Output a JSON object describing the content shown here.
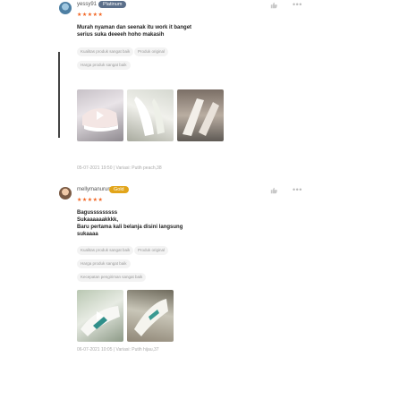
{
  "reviews": [
    {
      "username": "yessy91",
      "badge": "Platinum",
      "stars": "★★★★★",
      "text": [
        "Murah nyaman dan seenak itu work it banget",
        "serius suka deeeeh hoho makasih"
      ],
      "tags": [
        "Kualitas produk sangat baik",
        "Produk original",
        "Harga produk sangat baik"
      ],
      "meta": "05-07-2021 19:50 | Variasi: Putih peach,38"
    },
    {
      "username": "mellymanurung09",
      "badge": "Gold",
      "stars": "★★★★★",
      "text": [
        "Bagusssssssss",
        "Sukaaaaaakkkk,",
        "Baru pertama kali belanja disini langsung",
        "sukaaaa"
      ],
      "tags": [
        "Kualitas produk sangat baik",
        "Produk original",
        "Harga produk sangat baik",
        "Kecepatan pengiriman sangat baik"
      ],
      "meta": "06-07-2021 10:05 | Variasi: Putih hijau,37"
    }
  ],
  "colors": {
    "star": "#f26522",
    "platinum": "#5b6f8a",
    "gold": "#e2a51a",
    "tag_bg": "#f3f3f3"
  },
  "icons": {
    "like": "thumbs-up-icon",
    "more": "more-dots-icon",
    "play": "play-icon"
  }
}
